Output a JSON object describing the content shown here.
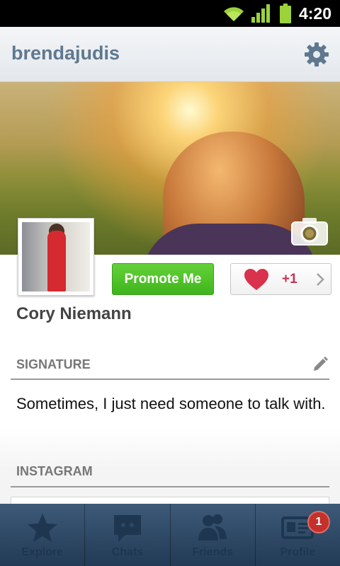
{
  "status_bar": {
    "time": "4:20"
  },
  "header": {
    "username": "brendajudis"
  },
  "profile": {
    "promote_label": "Promote Me",
    "like_count": "+1",
    "name": "Cory Niemann"
  },
  "signature": {
    "heading": "SIGNATURE",
    "text": "Sometimes, I just need someone to talk with."
  },
  "instagram": {
    "heading": "INSTAGRAM"
  },
  "tabs": [
    {
      "label": "Explore",
      "icon": "star-icon"
    },
    {
      "label": "Chats",
      "icon": "chat-icon"
    },
    {
      "label": "Friends",
      "icon": "friends-icon"
    },
    {
      "label": "Profile",
      "icon": "profile-card-icon",
      "badge": "1"
    }
  ],
  "colors": {
    "accent_green": "#4cbf25",
    "header_text": "#5f7890",
    "heart": "#d8324c",
    "tabbar": "#2d4866"
  }
}
